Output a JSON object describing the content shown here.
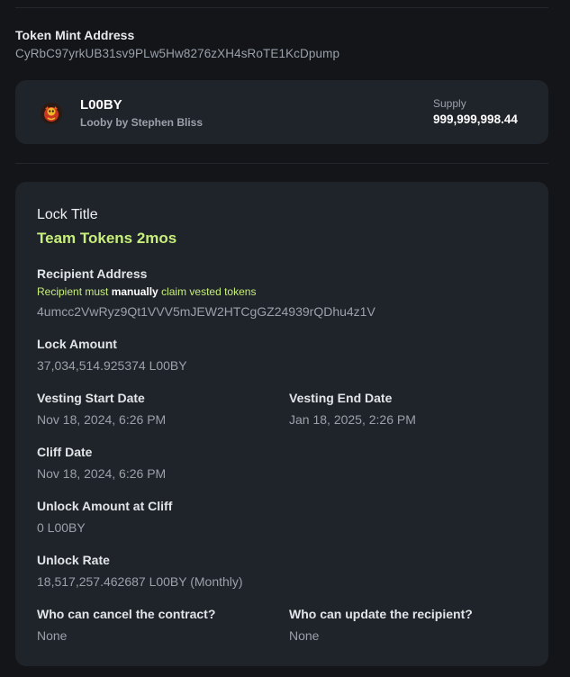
{
  "mint": {
    "label": "Token Mint Address",
    "address": "CyRbC97yrkUB31sv9PLw5Hw8276zXH4sRoTE1KcDpump"
  },
  "token": {
    "logo_icon": "token-logo-icon",
    "symbol": "L00BY",
    "name": "Looby by Stephen Bliss",
    "supply_label": "Supply",
    "supply_value": "999,999,998.44"
  },
  "lock": {
    "title_label": "Lock Title",
    "title_value": "Team Tokens 2mos",
    "recipient_label": "Recipient Address",
    "recipient_note_before": "Recipient must ",
    "recipient_note_bold": "manually",
    "recipient_note_after": " claim vested tokens",
    "recipient_address": "4umcc2VwRyz9Qt1VVV5mJEW2HTCgGZ24939rQDhu4z1V",
    "amount_label": "Lock Amount",
    "amount_value": "37,034,514.925374 L00BY",
    "vest_start_label": "Vesting Start Date",
    "vest_start_value": "Nov 18, 2024, 6:26 PM",
    "vest_end_label": "Vesting End Date",
    "vest_end_value": "Jan 18, 2025, 2:26 PM",
    "cliff_label": "Cliff Date",
    "cliff_value": "Nov 18, 2024, 6:26 PM",
    "unlock_cliff_label": "Unlock Amount at Cliff",
    "unlock_cliff_value": "0 L00BY",
    "rate_label": "Unlock Rate",
    "rate_value": "18,517,257.462687 L00BY (Monthly)",
    "cancel_label": "Who can cancel the contract?",
    "cancel_value": "None",
    "update_label": "Who can update the recipient?",
    "update_value": "None"
  },
  "colors": {
    "background": "#131519",
    "card": "#1f242a",
    "accent_green": "#c7ee7a",
    "muted_text": "#9aa1aa"
  }
}
